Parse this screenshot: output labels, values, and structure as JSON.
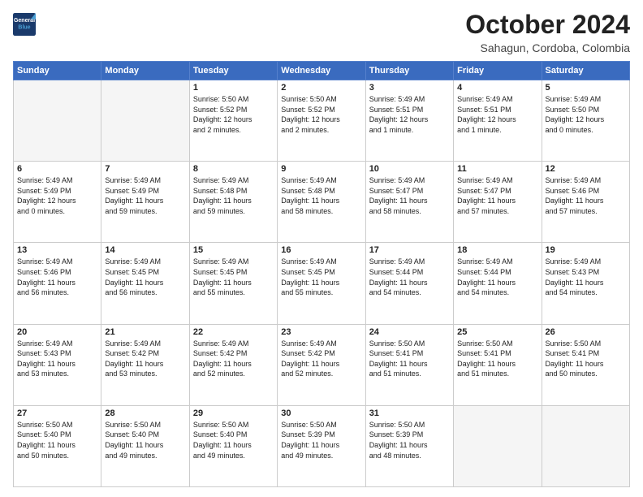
{
  "header": {
    "logo_line1": "General",
    "logo_line2": "Blue",
    "month_title": "October 2024",
    "location": "Sahagun, Cordoba, Colombia"
  },
  "weekdays": [
    "Sunday",
    "Monday",
    "Tuesday",
    "Wednesday",
    "Thursday",
    "Friday",
    "Saturday"
  ],
  "weeks": [
    [
      {
        "day": "",
        "text": ""
      },
      {
        "day": "",
        "text": ""
      },
      {
        "day": "1",
        "text": "Sunrise: 5:50 AM\nSunset: 5:52 PM\nDaylight: 12 hours\nand 2 minutes."
      },
      {
        "day": "2",
        "text": "Sunrise: 5:50 AM\nSunset: 5:52 PM\nDaylight: 12 hours\nand 2 minutes."
      },
      {
        "day": "3",
        "text": "Sunrise: 5:49 AM\nSunset: 5:51 PM\nDaylight: 12 hours\nand 1 minute."
      },
      {
        "day": "4",
        "text": "Sunrise: 5:49 AM\nSunset: 5:51 PM\nDaylight: 12 hours\nand 1 minute."
      },
      {
        "day": "5",
        "text": "Sunrise: 5:49 AM\nSunset: 5:50 PM\nDaylight: 12 hours\nand 0 minutes."
      }
    ],
    [
      {
        "day": "6",
        "text": "Sunrise: 5:49 AM\nSunset: 5:49 PM\nDaylight: 12 hours\nand 0 minutes."
      },
      {
        "day": "7",
        "text": "Sunrise: 5:49 AM\nSunset: 5:49 PM\nDaylight: 11 hours\nand 59 minutes."
      },
      {
        "day": "8",
        "text": "Sunrise: 5:49 AM\nSunset: 5:48 PM\nDaylight: 11 hours\nand 59 minutes."
      },
      {
        "day": "9",
        "text": "Sunrise: 5:49 AM\nSunset: 5:48 PM\nDaylight: 11 hours\nand 58 minutes."
      },
      {
        "day": "10",
        "text": "Sunrise: 5:49 AM\nSunset: 5:47 PM\nDaylight: 11 hours\nand 58 minutes."
      },
      {
        "day": "11",
        "text": "Sunrise: 5:49 AM\nSunset: 5:47 PM\nDaylight: 11 hours\nand 57 minutes."
      },
      {
        "day": "12",
        "text": "Sunrise: 5:49 AM\nSunset: 5:46 PM\nDaylight: 11 hours\nand 57 minutes."
      }
    ],
    [
      {
        "day": "13",
        "text": "Sunrise: 5:49 AM\nSunset: 5:46 PM\nDaylight: 11 hours\nand 56 minutes."
      },
      {
        "day": "14",
        "text": "Sunrise: 5:49 AM\nSunset: 5:45 PM\nDaylight: 11 hours\nand 56 minutes."
      },
      {
        "day": "15",
        "text": "Sunrise: 5:49 AM\nSunset: 5:45 PM\nDaylight: 11 hours\nand 55 minutes."
      },
      {
        "day": "16",
        "text": "Sunrise: 5:49 AM\nSunset: 5:45 PM\nDaylight: 11 hours\nand 55 minutes."
      },
      {
        "day": "17",
        "text": "Sunrise: 5:49 AM\nSunset: 5:44 PM\nDaylight: 11 hours\nand 54 minutes."
      },
      {
        "day": "18",
        "text": "Sunrise: 5:49 AM\nSunset: 5:44 PM\nDaylight: 11 hours\nand 54 minutes."
      },
      {
        "day": "19",
        "text": "Sunrise: 5:49 AM\nSunset: 5:43 PM\nDaylight: 11 hours\nand 54 minutes."
      }
    ],
    [
      {
        "day": "20",
        "text": "Sunrise: 5:49 AM\nSunset: 5:43 PM\nDaylight: 11 hours\nand 53 minutes."
      },
      {
        "day": "21",
        "text": "Sunrise: 5:49 AM\nSunset: 5:42 PM\nDaylight: 11 hours\nand 53 minutes."
      },
      {
        "day": "22",
        "text": "Sunrise: 5:49 AM\nSunset: 5:42 PM\nDaylight: 11 hours\nand 52 minutes."
      },
      {
        "day": "23",
        "text": "Sunrise: 5:49 AM\nSunset: 5:42 PM\nDaylight: 11 hours\nand 52 minutes."
      },
      {
        "day": "24",
        "text": "Sunrise: 5:50 AM\nSunset: 5:41 PM\nDaylight: 11 hours\nand 51 minutes."
      },
      {
        "day": "25",
        "text": "Sunrise: 5:50 AM\nSunset: 5:41 PM\nDaylight: 11 hours\nand 51 minutes."
      },
      {
        "day": "26",
        "text": "Sunrise: 5:50 AM\nSunset: 5:41 PM\nDaylight: 11 hours\nand 50 minutes."
      }
    ],
    [
      {
        "day": "27",
        "text": "Sunrise: 5:50 AM\nSunset: 5:40 PM\nDaylight: 11 hours\nand 50 minutes."
      },
      {
        "day": "28",
        "text": "Sunrise: 5:50 AM\nSunset: 5:40 PM\nDaylight: 11 hours\nand 49 minutes."
      },
      {
        "day": "29",
        "text": "Sunrise: 5:50 AM\nSunset: 5:40 PM\nDaylight: 11 hours\nand 49 minutes."
      },
      {
        "day": "30",
        "text": "Sunrise: 5:50 AM\nSunset: 5:39 PM\nDaylight: 11 hours\nand 49 minutes."
      },
      {
        "day": "31",
        "text": "Sunrise: 5:50 AM\nSunset: 5:39 PM\nDaylight: 11 hours\nand 48 minutes."
      },
      {
        "day": "",
        "text": ""
      },
      {
        "day": "",
        "text": ""
      }
    ]
  ]
}
